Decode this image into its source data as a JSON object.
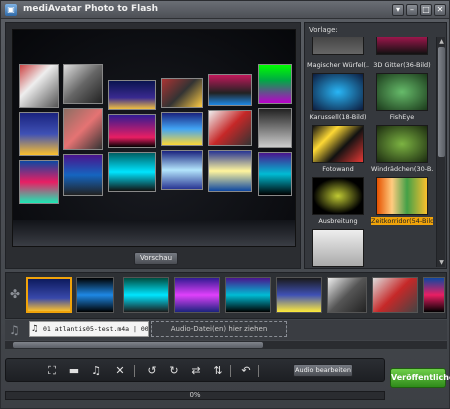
{
  "window": {
    "title": "mediAvatar Photo to Flash",
    "buttons": [
      "▾",
      "–",
      "□",
      "✕"
    ]
  },
  "preview": {
    "button_label": "Vorschau"
  },
  "templates": {
    "label": "Vorlage:",
    "selected_index": 7,
    "items": [
      {
        "label": "Magischer Würfel(...",
        "icon": "cube-thumb"
      },
      {
        "label": "3D Gitter(36-Bild)",
        "icon": "grid-thumb"
      },
      {
        "label": "Karussell(18-Bild)",
        "icon": "carousel-thumb"
      },
      {
        "label": "FishEye",
        "icon": "fisheye-thumb"
      },
      {
        "label": "Fotowand",
        "icon": "photowall-thumb"
      },
      {
        "label": "Windrädchen(30-B...",
        "icon": "pinwheel-thumb"
      },
      {
        "label": "Ausbreitung",
        "icon": "spread-thumb"
      },
      {
        "label": "Zeitkorridor(54-Bild)",
        "icon": "corridor-thumb"
      },
      {
        "label": "",
        "icon": "stack-thumb"
      },
      {
        "label": "",
        "icon": "empty-thumb"
      }
    ]
  },
  "filmstrip": {
    "selected_index": 0,
    "frame_count": 9
  },
  "audio": {
    "clip_text": "01 atlantis05-test.m4a | 00:00",
    "drop_text": "Audio-Datei(en) hier ziehen"
  },
  "toolbar": {
    "audio_edit_label": "Audio bearbeiten",
    "icons": [
      "crop-icon",
      "resize-icon",
      "music-note-icon",
      "delete-icon",
      "rotate-left-icon",
      "rotate-right-icon",
      "flip-horizontal-icon",
      "flip-vertical-icon",
      "undo-icon"
    ]
  },
  "publish": {
    "label": "Veröffentlichen"
  },
  "progress": {
    "value": 0,
    "text": "0%"
  },
  "colors": {
    "accent": "#f0a30a",
    "publish": "#4fae2e"
  }
}
